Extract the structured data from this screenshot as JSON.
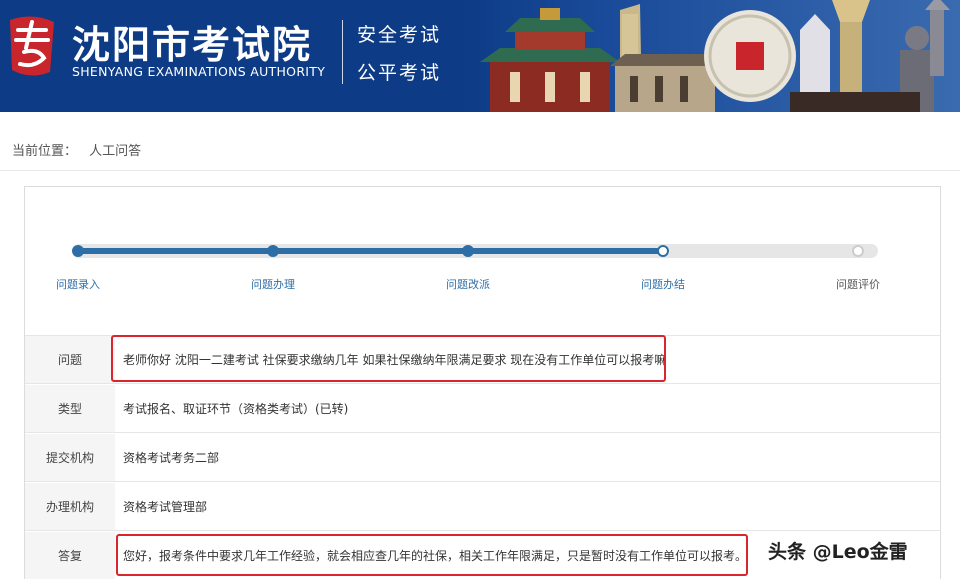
{
  "header": {
    "logo_char": "考",
    "title": "沈阳市考试院",
    "subtitle": "SHENYANG EXAMINATIONS AUTHORITY",
    "slogan_1": "安全考试",
    "slogan_2": "公平考试"
  },
  "breadcrumb": {
    "prefix": "当前位置：",
    "current": "人工问答"
  },
  "progress": {
    "completed_steps": 4,
    "total_steps": 5,
    "steps": [
      {
        "label": "问题录入"
      },
      {
        "label": "问题办理"
      },
      {
        "label": "问题改派"
      },
      {
        "label": "问题办结"
      },
      {
        "label": "问题评价"
      }
    ]
  },
  "details": {
    "question_label": "问题",
    "question_value": "老师你好 沈阳一二建考试 社保要求缴纳几年 如果社保缴纳年限满足要求 现在没有工作单位可以报考嘛",
    "type_label": "类型",
    "type_value": "考试报名、取证环节（资格类考试）(已转)",
    "submit_org_label": "提交机构",
    "submit_org_value": "资格考试考务二部",
    "handle_org_label": "办理机构",
    "handle_org_value": "资格考试管理部",
    "answer_label": "答复",
    "answer_value": "您好，报考条件中要求几年工作经验，就会相应查几年的社保，相关工作年限满足，只是暂时没有工作单位可以报考。"
  },
  "watermark": "头条 @Leo金雷",
  "colors": {
    "header_bg": "#0d3b86",
    "progress_blue": "#2e6ea6",
    "highlight_red": "#d9262c"
  }
}
